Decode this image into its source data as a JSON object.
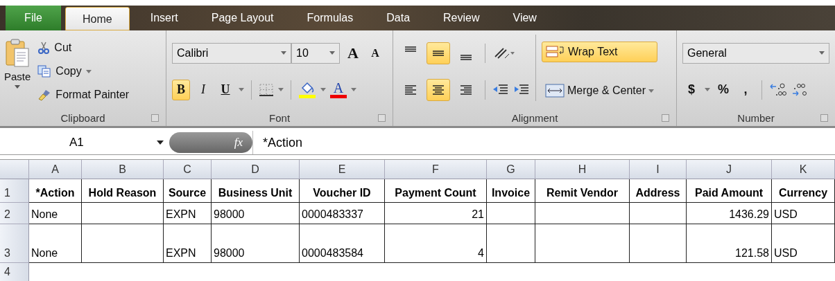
{
  "tabs": [
    {
      "label": "File",
      "kind": "file",
      "selected": false
    },
    {
      "label": "Home",
      "kind": "tab",
      "selected": true
    },
    {
      "label": "Insert",
      "kind": "tab",
      "selected": false
    },
    {
      "label": "Page Layout",
      "kind": "tab",
      "selected": false
    },
    {
      "label": "Formulas",
      "kind": "tab",
      "selected": false
    },
    {
      "label": "Data",
      "kind": "tab",
      "selected": false
    },
    {
      "label": "Review",
      "kind": "tab",
      "selected": false
    },
    {
      "label": "View",
      "kind": "tab",
      "selected": false
    }
  ],
  "clipboard": {
    "title": "Clipboard",
    "paste": "Paste",
    "cut": "Cut",
    "copy": "Copy",
    "format_painter": "Format Painter"
  },
  "font": {
    "title": "Font",
    "font_name": "Calibri",
    "font_size": "10",
    "grow": "A",
    "shrink": "A",
    "styles": [
      {
        "kind": "bold",
        "label": "B",
        "selected": true
      },
      {
        "kind": "italic",
        "label": "I",
        "selected": false
      },
      {
        "kind": "underline",
        "label": "U",
        "selected": false
      }
    ],
    "font_color": "A"
  },
  "alignment": {
    "title": "Alignment",
    "vertical": [
      {
        "kind": "top",
        "selected": false
      },
      {
        "kind": "middle",
        "selected": true
      },
      {
        "kind": "bottom",
        "selected": false
      }
    ],
    "horizontal": [
      {
        "kind": "left",
        "selected": false
      },
      {
        "kind": "center",
        "selected": true
      },
      {
        "kind": "right",
        "selected": false
      }
    ],
    "wrap_text": {
      "label": "Wrap Text",
      "selected": true
    },
    "merge": "Merge & Center"
  },
  "number": {
    "title": "Number",
    "format": "General",
    "currency": "$",
    "percent": "%",
    "comma": ","
  },
  "formula_bar": {
    "name_box": "A1",
    "fx": "fx",
    "formula": "*Action"
  },
  "sheet": {
    "columns": [
      {
        "letter": "A",
        "kind": "text"
      },
      {
        "letter": "B",
        "kind": "text"
      },
      {
        "letter": "C",
        "kind": "text"
      },
      {
        "letter": "D",
        "kind": "text"
      },
      {
        "letter": "E",
        "kind": "text"
      },
      {
        "letter": "F",
        "kind": "number"
      },
      {
        "letter": "G",
        "kind": "text"
      },
      {
        "letter": "H",
        "kind": "text"
      },
      {
        "letter": "I",
        "kind": "text"
      },
      {
        "letter": "J",
        "kind": "number"
      },
      {
        "letter": "K",
        "kind": "text"
      }
    ],
    "rows": [
      {
        "number": "1",
        "kind": "header",
        "cells": {
          "A": "*Action",
          "B": "Hold Reason",
          "C": "Source",
          "D": "Business Unit",
          "E": "Voucher ID",
          "F": "Payment Count",
          "G": "Invoice",
          "H": "Remit Vendor",
          "I": "Address",
          "J": "Paid Amount",
          "K": "Currency"
        }
      },
      {
        "number": "2",
        "kind": "data",
        "cells": {
          "A": "None",
          "C": "EXPN",
          "D": "98000",
          "E": "0000483337",
          "F": "21",
          "J": "1436.29",
          "K": "USD"
        }
      },
      {
        "number": "3",
        "kind": "tall",
        "cells": {
          "A": "None",
          "C": "EXPN",
          "D": "98000",
          "E": "0000483584",
          "F": "4",
          "J": "121.58",
          "K": "USD"
        }
      },
      {
        "number": "4",
        "kind": "empty",
        "cells": {}
      }
    ]
  }
}
